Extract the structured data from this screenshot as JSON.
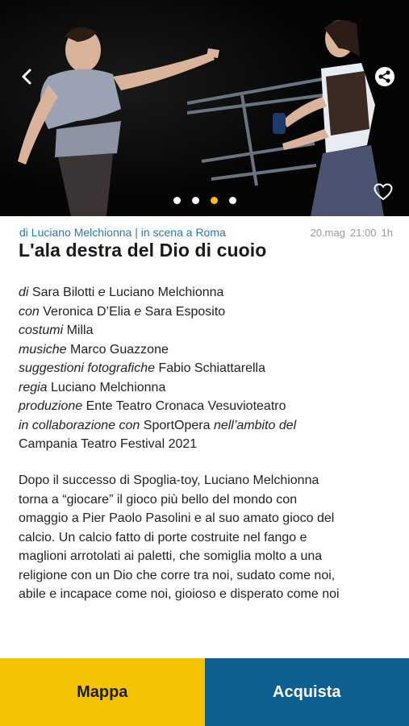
{
  "hero": {
    "image_alt": "Two actresses on a dark stage",
    "carousel_dots": 4,
    "active_dot": 2
  },
  "icons": {
    "back": "chevron-left-icon",
    "share": "share-icon",
    "favorite": "heart-outline-icon"
  },
  "event": {
    "category": "di Luciano Melchionna | in scena a Roma",
    "date": "20.mag",
    "time": "21:00",
    "duration": "1h",
    "title": "L'ala destra del Dio di cuoio"
  },
  "credits": {
    "author_role": "di",
    "author_1": "Sara Bilotti",
    "author_join": "e",
    "author_2": "Luciano Melchionna",
    "cast_role": "con",
    "cast": "Veronica D’Elia",
    "cast_join": "e",
    "cast_2": "Sara Esposito",
    "costumes_role": "costumi",
    "costumes": "Milla",
    "music_role": "musiche",
    "music": "Marco Guazzone",
    "photo_role": "suggestioni fotografiche",
    "photo": "Fabio Schiattarella",
    "direction_role": "regia",
    "direction": "Luciano Melchionna",
    "production_role": "produzione",
    "production": "Ente Teatro Cronaca Vesuvioteatro",
    "collab_role": "in collaborazione con",
    "collab": "SportOpera",
    "collab_context": "nell’ambito del",
    "festival": "Campania Teatro Festival 2021"
  },
  "description_lines": [
    "Dopo il successo di Spoglia-toy, Luciano Melchionna",
    "torna a “giocare” il gioco più bello del mondo con",
    "omaggio a Pier Paolo Pasolini e al suo amato gioco del",
    "calcio. Un calcio fatto di porte costruite nel fango e",
    "maglioni arrotolati ai paletti, che somiglia molto a una",
    "religione con un Dio che corre tra noi, sudato come noi,",
    "abile e incapace come noi, gioioso e disperato come noi"
  ],
  "actions": {
    "map_label": "Mappa",
    "buy_label": "Acquista"
  },
  "colors": {
    "accent_yellow": "#f5c200",
    "accent_blue": "#0e5e8f",
    "category_blue": "#2f7aa6"
  }
}
